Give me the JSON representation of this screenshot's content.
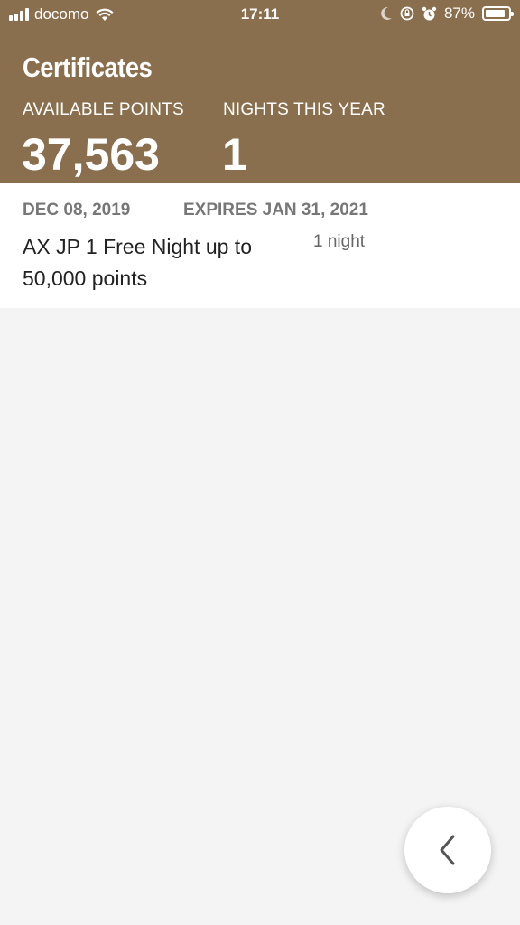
{
  "status_bar": {
    "carrier": "docomo",
    "time": "17:11",
    "battery": "87%",
    "battery_level": 0.87
  },
  "header": {
    "title": "Certificates",
    "available_points_label": "AVAILABLE POINTS",
    "available_points_value": "37,563",
    "nights_label": "NIGHTS THIS YEAR",
    "nights_value": "1",
    "background_color": "#8a6f4e"
  },
  "certificates": [
    {
      "date": "DEC 08, 2019",
      "expires": "EXPIRES JAN 31, 2021",
      "name": "AX JP 1 Free Night up to 50,000 points",
      "nights": "1 night"
    }
  ],
  "back_button": {
    "icon": "chevron-left-icon"
  }
}
